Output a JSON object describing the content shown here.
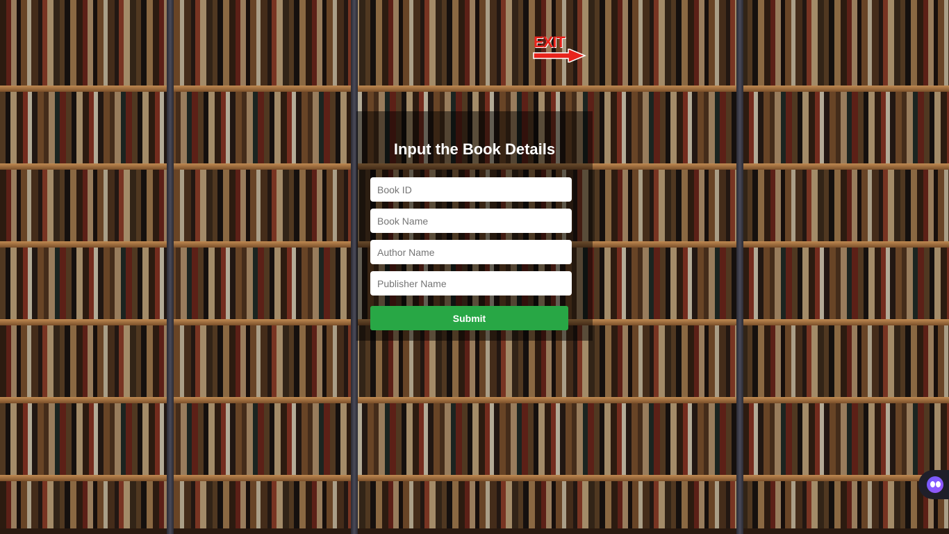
{
  "form": {
    "title": "Input the Book Details",
    "fields": [
      {
        "name": "book-id",
        "placeholder": "Book ID",
        "value": ""
      },
      {
        "name": "book-name",
        "placeholder": "Book Name",
        "value": ""
      },
      {
        "name": "author-name",
        "placeholder": "Author Name",
        "value": ""
      },
      {
        "name": "publisher-name",
        "placeholder": "Publisher Name",
        "value": ""
      }
    ],
    "submit_label": "Submit"
  },
  "exit": {
    "label": "EXIT",
    "icon": "arrow-right-icon",
    "color": "#e8231c"
  },
  "widget": {
    "icon": "assistant-face-icon"
  },
  "colors": {
    "submit": "#28a745",
    "title": "#ffffff"
  }
}
